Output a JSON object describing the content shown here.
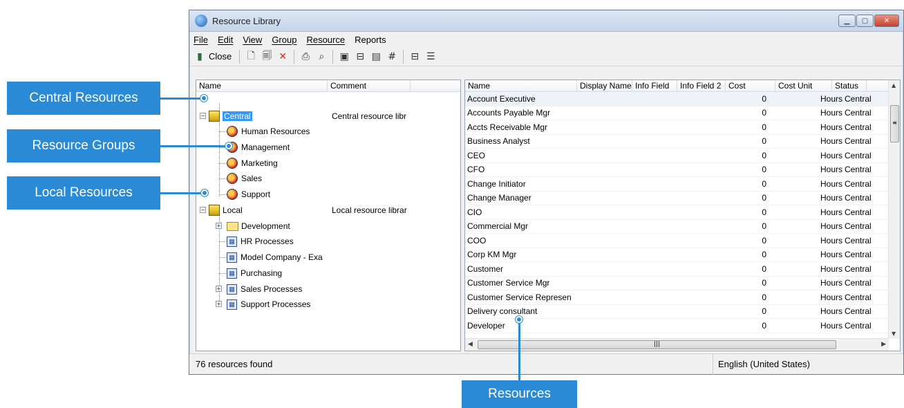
{
  "window": {
    "title": "Resource Library"
  },
  "menu": [
    "File",
    "Edit",
    "View",
    "Group",
    "Resource",
    "Reports"
  ],
  "toolbar": {
    "close_label": "Close"
  },
  "tree": {
    "headers": {
      "name": "Name",
      "comment": "Comment"
    },
    "nodes": {
      "central": {
        "label": "Central",
        "comment": "Central resource libr"
      },
      "human_resources": "Human Resources",
      "management": "Management",
      "marketing": "Marketing",
      "sales": "Sales",
      "support": "Support",
      "local": {
        "label": "Local",
        "comment": "Local resource librar"
      },
      "development": "Development",
      "hr_processes": "HR Processes",
      "model_company": "Model Company - Exa",
      "purchasing": "Purchasing",
      "sales_processes": "Sales Processes",
      "support_processes": "Support Processes"
    }
  },
  "grid": {
    "headers": [
      "Name",
      "Display Name",
      "Info Field",
      "Info Field 2",
      "Cost",
      "Cost Unit",
      "Status"
    ],
    "rows": [
      {
        "name": "Account Executive",
        "cost": "0",
        "unit": "Hours",
        "status": "Central"
      },
      {
        "name": "Accounts Payable Mgr",
        "cost": "0",
        "unit": "Hours",
        "status": "Central"
      },
      {
        "name": "Accts Receivable Mgr",
        "cost": "0",
        "unit": "Hours",
        "status": "Central"
      },
      {
        "name": "Business Analyst",
        "cost": "0",
        "unit": "Hours",
        "status": "Central"
      },
      {
        "name": "CEO",
        "cost": "0",
        "unit": "Hours",
        "status": "Central"
      },
      {
        "name": "CFO",
        "cost": "0",
        "unit": "Hours",
        "status": "Central"
      },
      {
        "name": "Change Initiator",
        "cost": "0",
        "unit": "Hours",
        "status": "Central"
      },
      {
        "name": "Change Manager",
        "cost": "0",
        "unit": "Hours",
        "status": "Central"
      },
      {
        "name": "CIO",
        "cost": "0",
        "unit": "Hours",
        "status": "Central"
      },
      {
        "name": "Commercial Mgr",
        "cost": "0",
        "unit": "Hours",
        "status": "Central"
      },
      {
        "name": "COO",
        "cost": "0",
        "unit": "Hours",
        "status": "Central"
      },
      {
        "name": "Corp KM Mgr",
        "cost": "0",
        "unit": "Hours",
        "status": "Central"
      },
      {
        "name": "Customer",
        "cost": "0",
        "unit": "Hours",
        "status": "Central"
      },
      {
        "name": "Customer Service Mgr",
        "cost": "0",
        "unit": "Hours",
        "status": "Central"
      },
      {
        "name": "Customer Service Represen",
        "cost": "0",
        "unit": "Hours",
        "status": "Central"
      },
      {
        "name": "Delivery consultant",
        "cost": "0",
        "unit": "Hours",
        "status": "Central"
      },
      {
        "name": "Developer",
        "cost": "0",
        "unit": "Hours",
        "status": "Central"
      }
    ]
  },
  "status": {
    "left": "76 resources found",
    "right": "English (United States)"
  },
  "callouts": {
    "central": "Central Resources",
    "groups": "Resource Groups",
    "local": "Local Resources",
    "resources": "Resources"
  },
  "colors": {
    "callout": "#2a8ad6",
    "selection": "#3399ff"
  }
}
